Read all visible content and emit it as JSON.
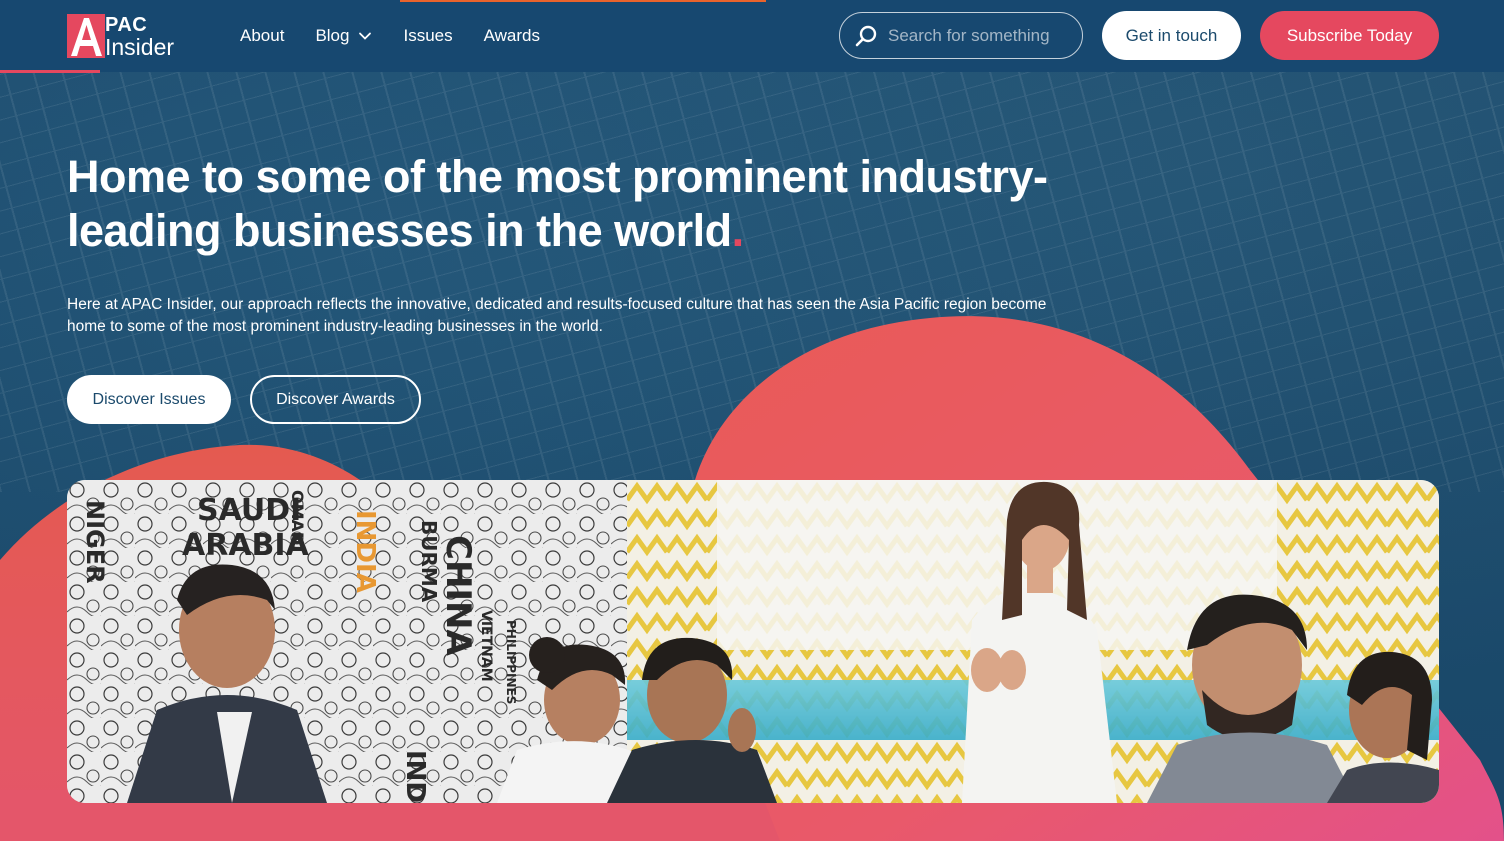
{
  "header": {
    "logo_line1": "PAC",
    "logo_line2": "Insider",
    "nav": [
      {
        "label": "About"
      },
      {
        "label": "Blog"
      },
      {
        "label": "Issues"
      },
      {
        "label": "Awards"
      }
    ],
    "search_placeholder": "Search for something",
    "contact_label": "Get in touch",
    "subscribe_label": "Subscribe Today"
  },
  "hero": {
    "title": "Home to some of the most prominent industry-leading businesses in the world",
    "title_dot": ".",
    "description": "Here at APAC Insider, our approach reflects the innovative, dedicated and results-focused culture that has seen the Asia Pacific region become home to some of the most prominent industry-leading businesses in the world.",
    "btn_issues": "Discover Issues",
    "btn_awards": "Discover Awards"
  },
  "photo": {
    "wall_words": [
      "SAUDI",
      "ARABIA",
      "CHINA",
      "INDIA",
      "OMAN",
      "BURMA",
      "NIGER",
      "VIETNAM",
      "PHILIPPINES",
      "INDON"
    ]
  },
  "colors": {
    "navy": "#1b4a6c",
    "coral": "#e5485f",
    "orange_accent": "#e9632c"
  }
}
